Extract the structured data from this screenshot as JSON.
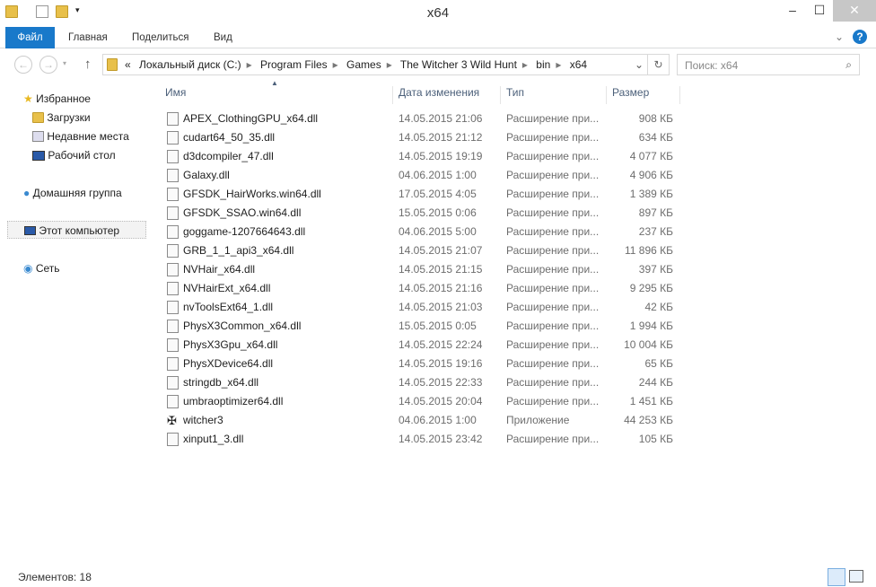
{
  "window": {
    "title": "x64"
  },
  "ribbon": {
    "tabs": [
      "Файл",
      "Главная",
      "Поделиться",
      "Вид"
    ]
  },
  "address": {
    "parts": [
      "Локальный диск (C:)",
      "Program Files",
      "Games",
      "The Witcher 3 Wild Hunt",
      "bin",
      "x64"
    ]
  },
  "search": {
    "placeholder": "Поиск: x64"
  },
  "nav": {
    "favorites": "Избранное",
    "downloads": "Загрузки",
    "recent": "Недавние места",
    "desktop": "Рабочий стол",
    "homegroup": "Домашняя группа",
    "computer": "Этот компьютер",
    "network": "Сеть"
  },
  "columns": {
    "name": "Имя",
    "date": "Дата изменения",
    "type": "Тип",
    "size": "Размер"
  },
  "files": [
    {
      "name": "APEX_ClothingGPU_x64.dll",
      "date": "14.05.2015 21:06",
      "type": "Расширение при...",
      "size": "908 КБ"
    },
    {
      "name": "cudart64_50_35.dll",
      "date": "14.05.2015 21:12",
      "type": "Расширение при...",
      "size": "634 КБ"
    },
    {
      "name": "d3dcompiler_47.dll",
      "date": "14.05.2015 19:19",
      "type": "Расширение при...",
      "size": "4 077 КБ"
    },
    {
      "name": "Galaxy.dll",
      "date": "04.06.2015 1:00",
      "type": "Расширение при...",
      "size": "4 906 КБ"
    },
    {
      "name": "GFSDK_HairWorks.win64.dll",
      "date": "17.05.2015 4:05",
      "type": "Расширение при...",
      "size": "1 389 КБ"
    },
    {
      "name": "GFSDK_SSAO.win64.dll",
      "date": "15.05.2015 0:06",
      "type": "Расширение при...",
      "size": "897 КБ"
    },
    {
      "name": "goggame-1207664643.dll",
      "date": "04.06.2015 5:00",
      "type": "Расширение при...",
      "size": "237 КБ"
    },
    {
      "name": "GRB_1_1_api3_x64.dll",
      "date": "14.05.2015 21:07",
      "type": "Расширение при...",
      "size": "11 896 КБ"
    },
    {
      "name": "NVHair_x64.dll",
      "date": "14.05.2015 21:15",
      "type": "Расширение при...",
      "size": "397 КБ"
    },
    {
      "name": "NVHairExt_x64.dll",
      "date": "14.05.2015 21:16",
      "type": "Расширение при...",
      "size": "9 295 КБ"
    },
    {
      "name": "nvToolsExt64_1.dll",
      "date": "14.05.2015 21:03",
      "type": "Расширение при...",
      "size": "42 КБ"
    },
    {
      "name": "PhysX3Common_x64.dll",
      "date": "15.05.2015 0:05",
      "type": "Расширение при...",
      "size": "1 994 КБ"
    },
    {
      "name": "PhysX3Gpu_x64.dll",
      "date": "14.05.2015 22:24",
      "type": "Расширение при...",
      "size": "10 004 КБ"
    },
    {
      "name": "PhysXDevice64.dll",
      "date": "14.05.2015 19:16",
      "type": "Расширение при...",
      "size": "65 КБ"
    },
    {
      "name": "stringdb_x64.dll",
      "date": "14.05.2015 22:33",
      "type": "Расширение при...",
      "size": "244 КБ"
    },
    {
      "name": "umbraoptimizer64.dll",
      "date": "14.05.2015 20:04",
      "type": "Расширение при...",
      "size": "1 451 КБ"
    },
    {
      "name": "witcher3",
      "date": "04.06.2015 1:00",
      "type": "Приложение",
      "size": "44 253 КБ"
    },
    {
      "name": "xinput1_3.dll",
      "date": "14.05.2015 23:42",
      "type": "Расширение при...",
      "size": "105 КБ"
    }
  ],
  "status": {
    "items": "Элементов: 18"
  }
}
